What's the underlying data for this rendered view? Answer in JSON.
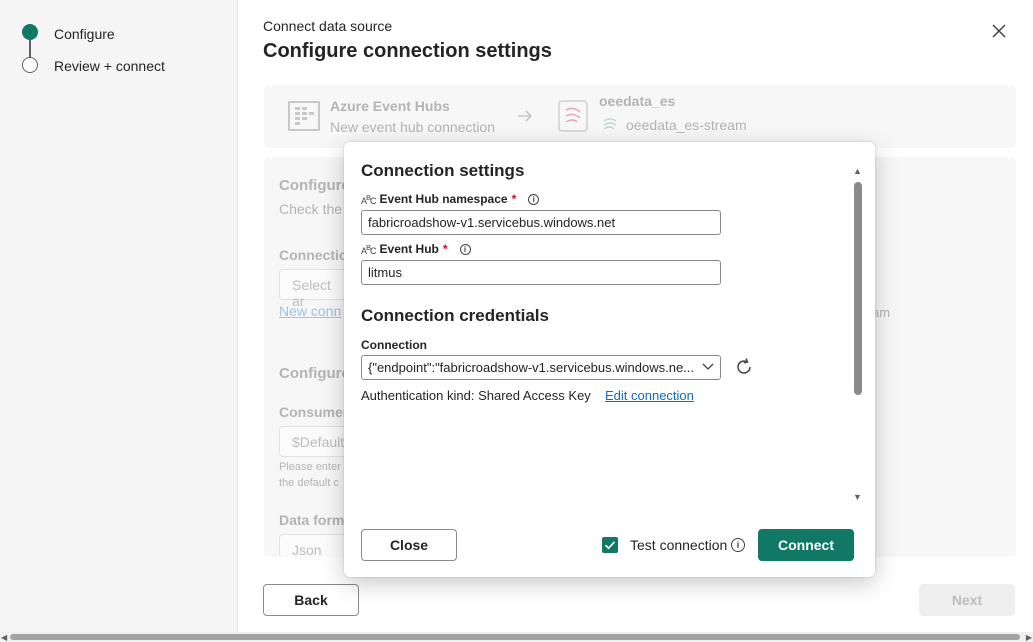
{
  "steps": {
    "items": [
      {
        "label": "Configure",
        "state": "complete"
      },
      {
        "label": "Review + connect",
        "state": "pending"
      }
    ]
  },
  "header": {
    "kicker": "Connect data source",
    "title": "Configure connection settings"
  },
  "source_card": {
    "source_name": "Azure Event Hubs",
    "source_sub": "New event hub connection",
    "dest_name": "oeedata_es",
    "dest_sub": "oeedata_es-stream"
  },
  "background": {
    "configure_heading": "Configure",
    "configure_hint": "Check the",
    "connection_label": "Connection",
    "select_placeholder": "Select ar",
    "new_connection_link": "New conn",
    "configure2_heading": "Configure",
    "consumer_label": "Consumer",
    "consumer_value": "$Default",
    "consumer_hint_1": "Please enter",
    "consumer_hint_2": "the default c",
    "data_format_label": "Data form",
    "data_format_value": "Json",
    "right_fragment": "am"
  },
  "footer": {
    "back_label": "Back",
    "next_label": "Next"
  },
  "dialog": {
    "settings_heading": "Connection settings",
    "namespace_label": "Event Hub namespace",
    "namespace_value": "fabricroadshow-v1.servicebus.windows.net",
    "eventhub_label": "Event Hub",
    "eventhub_value": "litmus",
    "required_mark": "*",
    "credentials_heading": "Connection credentials",
    "connection_label": "Connection",
    "connection_value": "{\"endpoint\":\"fabricroadshow-v1.servicebus.windows.ne...",
    "auth_text": "Authentication kind: Shared Access Key",
    "edit_link": "Edit connection",
    "close_label": "Close",
    "test_connection_label": "Test connection",
    "test_connection_checked": true,
    "connect_label": "Connect",
    "abc_icon": "text-field-icon"
  },
  "colors": {
    "accent": "#117865",
    "link": "#0f6cbd",
    "required": "#c50f1f"
  }
}
